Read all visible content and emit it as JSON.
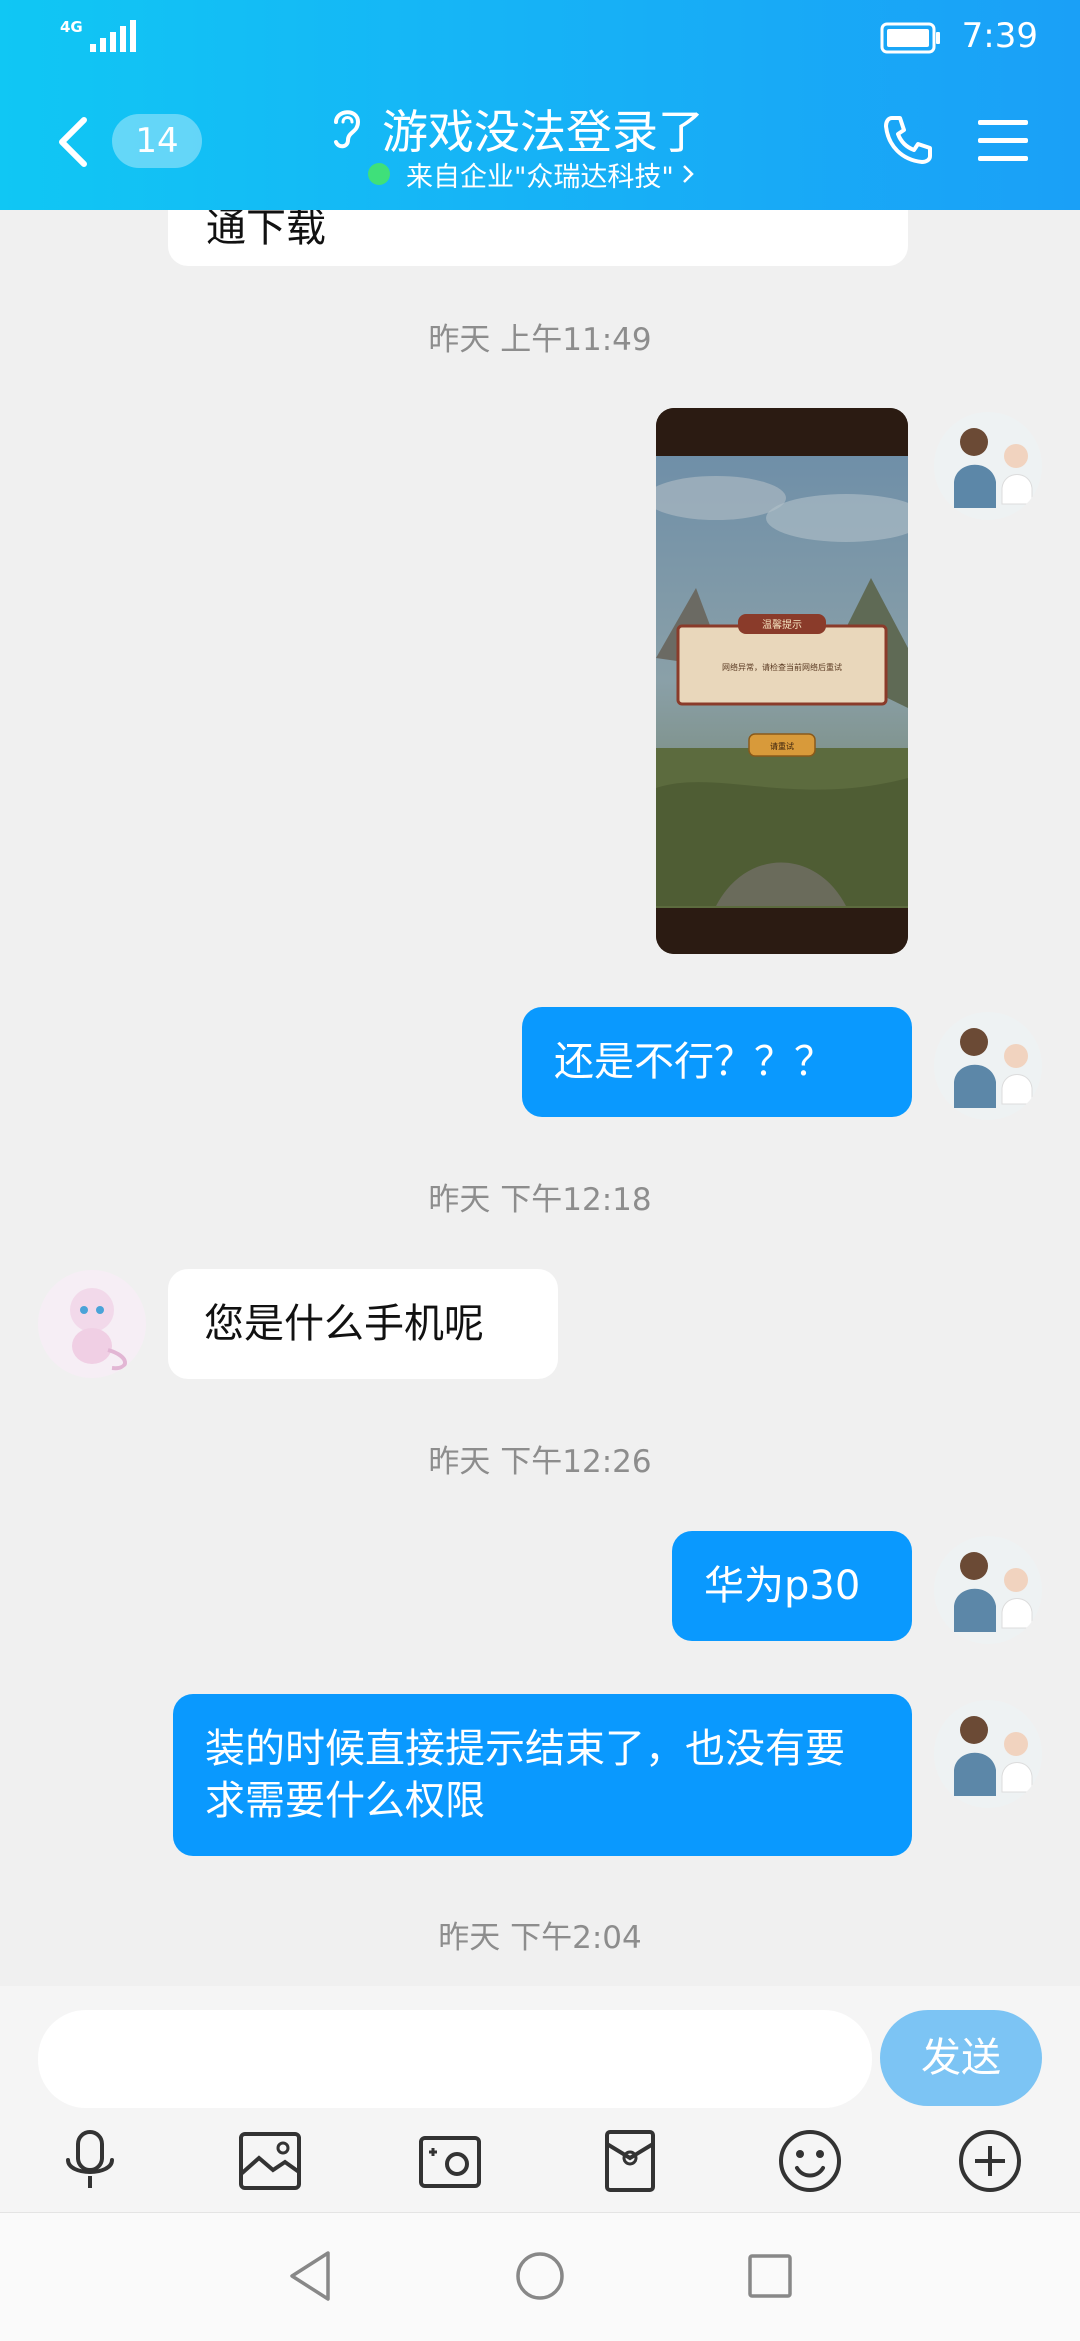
{
  "status_bar": {
    "network": "4G",
    "time": "7:39"
  },
  "header": {
    "unread_count": "14",
    "title": "游戏没法登录了",
    "subtitle": "来自企业\"众瑞达科技\""
  },
  "messages": {
    "partial_top_text": "通下载",
    "ts1": "昨天 上午11:49",
    "image_dialog": {
      "title": "温馨提示",
      "text": "网络异常，请检查当前网络后重试",
      "button": "请重试"
    },
    "msg_out_1": "还是不行？？？",
    "ts2": "昨天 下午12:18",
    "msg_in_1": "您是什么手机呢",
    "ts3": "昨天 下午12:26",
    "msg_out_2": "华为p30",
    "msg_out_3": "装的时候直接提示结束了，也没有要求需要什么权限",
    "ts4": "昨天 下午2:04"
  },
  "input": {
    "placeholder": "",
    "send_label": "发送"
  },
  "toolbar": [
    "mic-icon",
    "image-icon",
    "camera-icon",
    "red-packet-icon",
    "emoji-icon",
    "plus-icon"
  ],
  "colors": {
    "header_start": "#10c7f4",
    "header_end": "#1aa0f7",
    "bubble_out": "#0a99fe",
    "send_button": "#7cc4f4",
    "background": "#f0f0f0"
  }
}
